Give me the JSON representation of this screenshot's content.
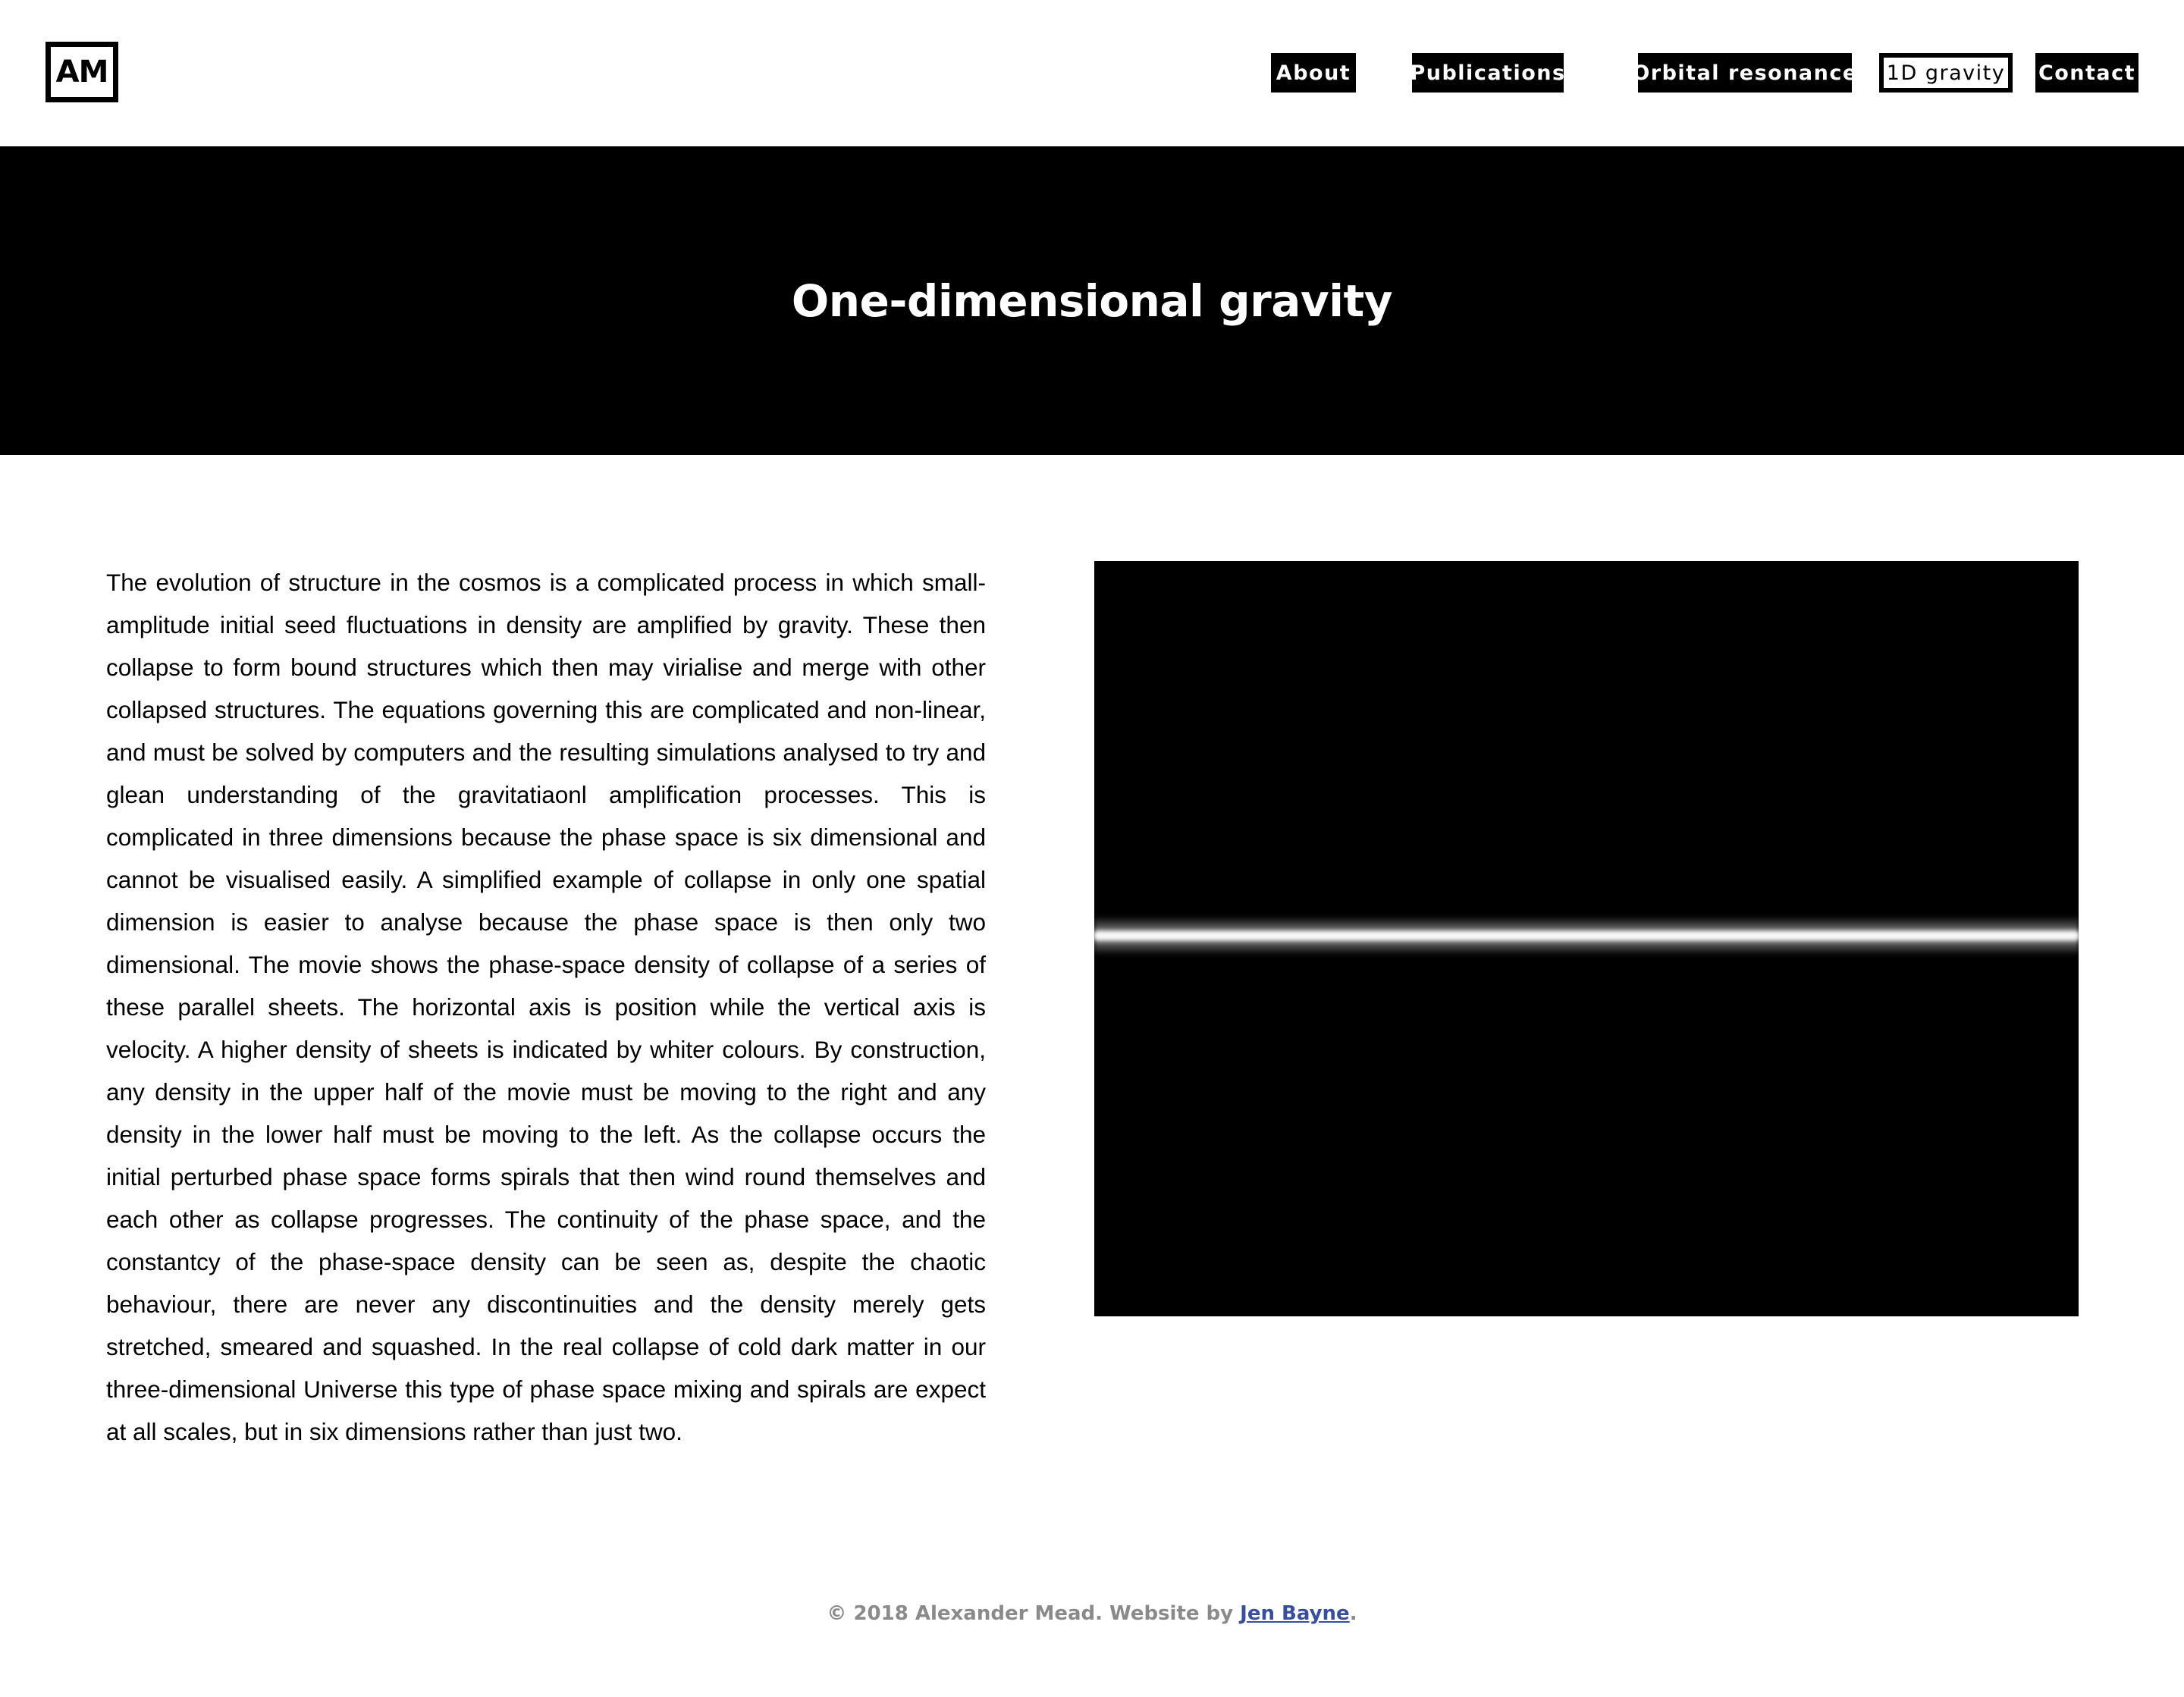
{
  "header": {
    "logo_text": "AM",
    "nav": [
      {
        "label": "About",
        "active": false
      },
      {
        "label": "Publications",
        "active": false
      },
      {
        "label": "Orbital resonance",
        "active": false
      },
      {
        "label": "1D gravity",
        "active": true
      },
      {
        "label": "Contact",
        "active": false
      }
    ]
  },
  "hero": {
    "title": "One-dimensional gravity"
  },
  "main": {
    "paragraph": "The evolution of structure in the cosmos is a complicated process in which small-amplitude initial seed fluctuations in density are amplified by gravity. These then collapse to form bound structures which then may virialise and merge with other collapsed structures. The equations governing this are complicated and non-linear, and must be solved by computers and the resulting simulations analysed to try and glean understanding of the gravitatiaonl amplification processes. This is complicated in three dimensions because the phase space is six dimensional and cannot be visualised easily. A simplified example of collapse in only one spatial dimension is easier to analyse because the phase space is then only two dimensional. The movie shows the phase-space density of collapse of a series of these parallel sheets. The horizontal axis is position while the vertical axis is velocity. A higher density of sheets is indicated by whiter colours. By construction, any density in the upper half of the movie must be moving to the right and any density in the lower half must be moving to the left. As the collapse occurs the initial perturbed phase space forms spirals that then wind round themselves and each other as collapse progresses. The continuity of the phase space, and the constantcy of the phase-space density can be seen as, despite the chaotic behaviour, there are never any discontinuities and the density merely gets stretched, smeared and squashed. In the real collapse of cold dark matter in our three-dimensional Universe this type of phase space mixing and spirals are expect at all scales, but in six dimensions rather than just two."
  },
  "footer": {
    "prefix": "© 2018 Alexander Mead. Website by ",
    "link_text": "Jen Bayne",
    "suffix": "."
  },
  "colors": {
    "background": "#ffffff",
    "hero_background": "#000000",
    "nav_background": "#000000",
    "footer_text": "#8a8a8a",
    "link": "#3a4e9e"
  }
}
